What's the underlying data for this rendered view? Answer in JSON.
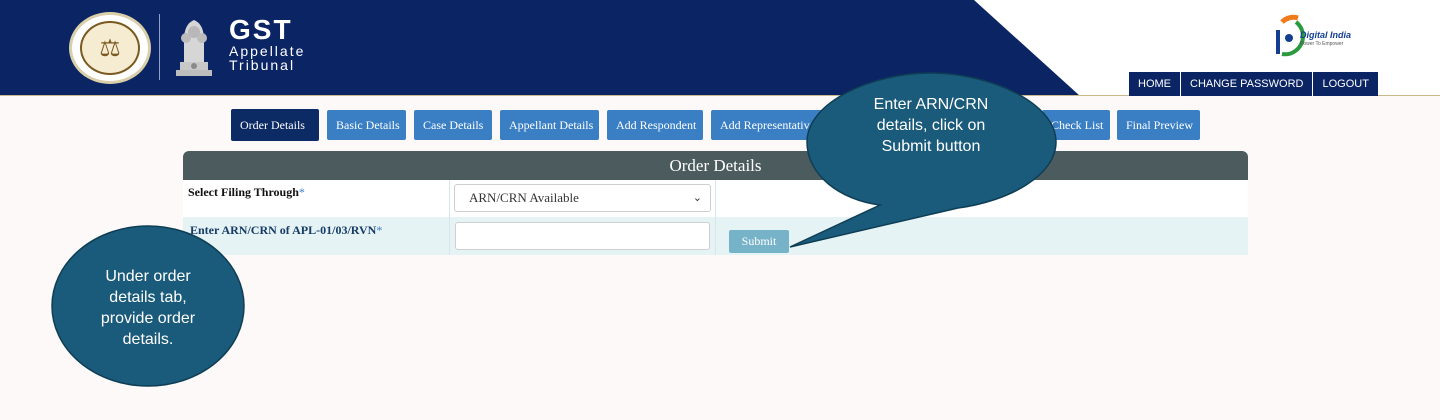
{
  "header": {
    "title": "GST",
    "subtitle_line1": "Appellate",
    "subtitle_line2": "Tribunal",
    "digital_india_name": "Digital India",
    "digital_india_tagline": "Power To Empower",
    "colors": {
      "navy": "#0b2463",
      "accent_blue": "#3a7fc4"
    }
  },
  "topnav": {
    "items": [
      {
        "label": "HOME"
      },
      {
        "label": "CHANGE PASSWORD"
      },
      {
        "label": "LOGOUT"
      }
    ]
  },
  "tabs": [
    {
      "label": "Order Details",
      "active": true
    },
    {
      "label": "Basic Details",
      "active": false
    },
    {
      "label": "Case Details",
      "active": false
    },
    {
      "label": "Appellant Details",
      "active": false
    },
    {
      "label": "Add Respondent",
      "active": false
    },
    {
      "label": "Add Representative",
      "active": false
    },
    {
      "label": "Check List",
      "active": false
    },
    {
      "label": "Final Preview",
      "active": false
    }
  ],
  "panel": {
    "title": "Order Details",
    "filing_label": "Select Filing Through",
    "filing_value": "ARN/CRN Available",
    "arn_label": "Enter ARN/CRN of APL-01/03/RVN",
    "arn_value": "",
    "required_mark": "*",
    "submit_label": "Submit"
  },
  "callouts": {
    "top": [
      "Enter ARN/CRN",
      "details, click on",
      "Submit button"
    ],
    "left": [
      "Under order",
      "details tab,",
      "provide order",
      "details."
    ]
  }
}
